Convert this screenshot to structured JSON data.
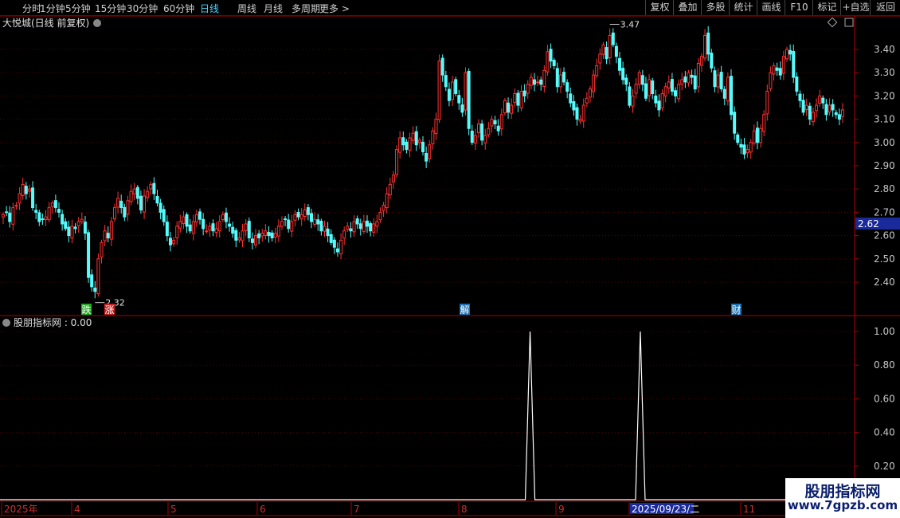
{
  "toolbar": {
    "left": [
      "分时",
      "1分钟",
      "5分钟",
      "15分钟",
      "30分钟",
      "60分钟",
      "日线",
      "周线",
      "月线",
      "多周期",
      "更多 >"
    ],
    "active": "日线",
    "right": [
      "复权",
      "叠加",
      "多股",
      "统计",
      "画线",
      "F10",
      "标记",
      "+自选",
      "返回"
    ]
  },
  "main_panel": {
    "title": "大悦城(日线 前复权)",
    "high_label": "3.47",
    "low_label": "2.32",
    "current_price": "2.62",
    "signals": [
      {
        "label": "跌",
        "color": "#1fa81f"
      },
      {
        "label": "涨",
        "color": "#c81e1e"
      },
      {
        "label": "解",
        "color": "#1c6fb0"
      },
      {
        "label": "财",
        "color": "#1c6fb0"
      }
    ]
  },
  "indicator_panel": {
    "title": "股朋指标网 : 0.00"
  },
  "x_axis": {
    "labels": [
      "2025年",
      "4",
      "5",
      "6",
      "7",
      "8",
      "9",
      "2025/09/23/二",
      "11"
    ],
    "highlight": "2025/09/23/二"
  },
  "watermark": {
    "line1": "股朋指标网",
    "line2": "www.7gpzb.com"
  },
  "colors": {
    "up": "#ff3232",
    "down": "#54fcfc",
    "axis": "#b00000",
    "grid": "#5a0000",
    "price_box": "#1a2a9a"
  },
  "chart_data": [
    {
      "type": "candlestick",
      "title": "大悦城(日线 前复权)",
      "y_axis_ticks": [
        "3.40",
        "3.30",
        "3.20",
        "3.10",
        "3.00",
        "2.90",
        "2.80",
        "2.70",
        "2.60",
        "2.50",
        "2.40"
      ],
      "ylim": [
        2.3,
        3.5
      ],
      "annotations": [
        {
          "text": "3.47"
        },
        {
          "text": "2.32"
        },
        {
          "text": "2.62"
        }
      ],
      "close": [
        2.69,
        2.7,
        2.66,
        2.72,
        2.73,
        2.78,
        2.82,
        2.78,
        2.8,
        2.72,
        2.7,
        2.66,
        2.67,
        2.68,
        2.72,
        2.74,
        2.72,
        2.7,
        2.65,
        2.63,
        2.6,
        2.64,
        2.63,
        2.66,
        2.67,
        2.61,
        2.42,
        2.38,
        2.36,
        2.5,
        2.57,
        2.62,
        2.59,
        2.66,
        2.72,
        2.76,
        2.72,
        2.68,
        2.75,
        2.79,
        2.8,
        2.76,
        2.71,
        2.77,
        2.79,
        2.82,
        2.78,
        2.74,
        2.7,
        2.66,
        2.6,
        2.56,
        2.58,
        2.64,
        2.66,
        2.68,
        2.64,
        2.62,
        2.66,
        2.69,
        2.67,
        2.63,
        2.62,
        2.64,
        2.62,
        2.63,
        2.66,
        2.69,
        2.66,
        2.64,
        2.61,
        2.58,
        2.59,
        2.62,
        2.65,
        2.59,
        2.57,
        2.6,
        2.59,
        2.61,
        2.62,
        2.6,
        2.59,
        2.61,
        2.64,
        2.66,
        2.67,
        2.63,
        2.66,
        2.69,
        2.68,
        2.69,
        2.71,
        2.69,
        2.66,
        2.67,
        2.65,
        2.62,
        2.64,
        2.6,
        2.57,
        2.55,
        2.53,
        2.58,
        2.62,
        2.64,
        2.62,
        2.66,
        2.65,
        2.63,
        2.66,
        2.64,
        2.62,
        2.65,
        2.66,
        2.7,
        2.73,
        2.78,
        2.82,
        2.86,
        2.97,
        3.02,
        2.99,
        2.97,
        3.02,
        3.04,
        2.99,
        3.01,
        2.96,
        2.92,
        2.99,
        3.05,
        3.1,
        3.35,
        3.29,
        3.24,
        3.18,
        3.26,
        3.21,
        3.17,
        3.13,
        3.3,
        3.06,
        3.0,
        3.03,
        3.08,
        3.01,
        3.03,
        3.06,
        3.1,
        3.08,
        3.05,
        3.12,
        3.18,
        3.13,
        3.16,
        3.21,
        3.16,
        3.22,
        3.2,
        3.25,
        3.28,
        3.25,
        3.26,
        3.25,
        3.31,
        3.39,
        3.35,
        3.33,
        3.24,
        3.29,
        3.26,
        3.22,
        3.17,
        3.14,
        3.1,
        3.1,
        3.16,
        3.19,
        3.23,
        3.29,
        3.33,
        3.38,
        3.42,
        3.36,
        3.46,
        3.42,
        3.37,
        3.31,
        3.27,
        3.25,
        3.16,
        3.2,
        3.25,
        3.3,
        3.25,
        3.19,
        3.27,
        3.21,
        3.17,
        3.14,
        3.21,
        3.24,
        3.26,
        3.22,
        3.2,
        3.25,
        3.27,
        3.26,
        3.3,
        3.28,
        3.23,
        3.34,
        3.37,
        3.46,
        3.38,
        3.32,
        3.24,
        3.29,
        3.23,
        3.19,
        3.28,
        3.12,
        3.04,
        3.0,
        2.98,
        2.95,
        2.97,
        3.0,
        3.05,
        3.0,
        3.06,
        3.12,
        3.22,
        3.3,
        3.33,
        3.31,
        3.29,
        3.37,
        3.4,
        3.38,
        3.28,
        3.22,
        3.18,
        3.13,
        3.16,
        3.1,
        3.13,
        3.16,
        3.2,
        3.17,
        3.12,
        3.16,
        3.14,
        3.12,
        3.1,
        3.14
      ]
    },
    {
      "type": "line",
      "title": "股朋指标网 : 0.00",
      "y_axis_ticks": [
        "1.00",
        "0.80",
        "0.60",
        "0.40",
        "0.20"
      ],
      "ylim": [
        0,
        1.05
      ],
      "spikes": [
        {
          "x_fraction": 0.577,
          "value": 1.0
        },
        {
          "x_fraction": 0.697,
          "value": 1.0
        }
      ],
      "baseline": 0.0
    }
  ]
}
